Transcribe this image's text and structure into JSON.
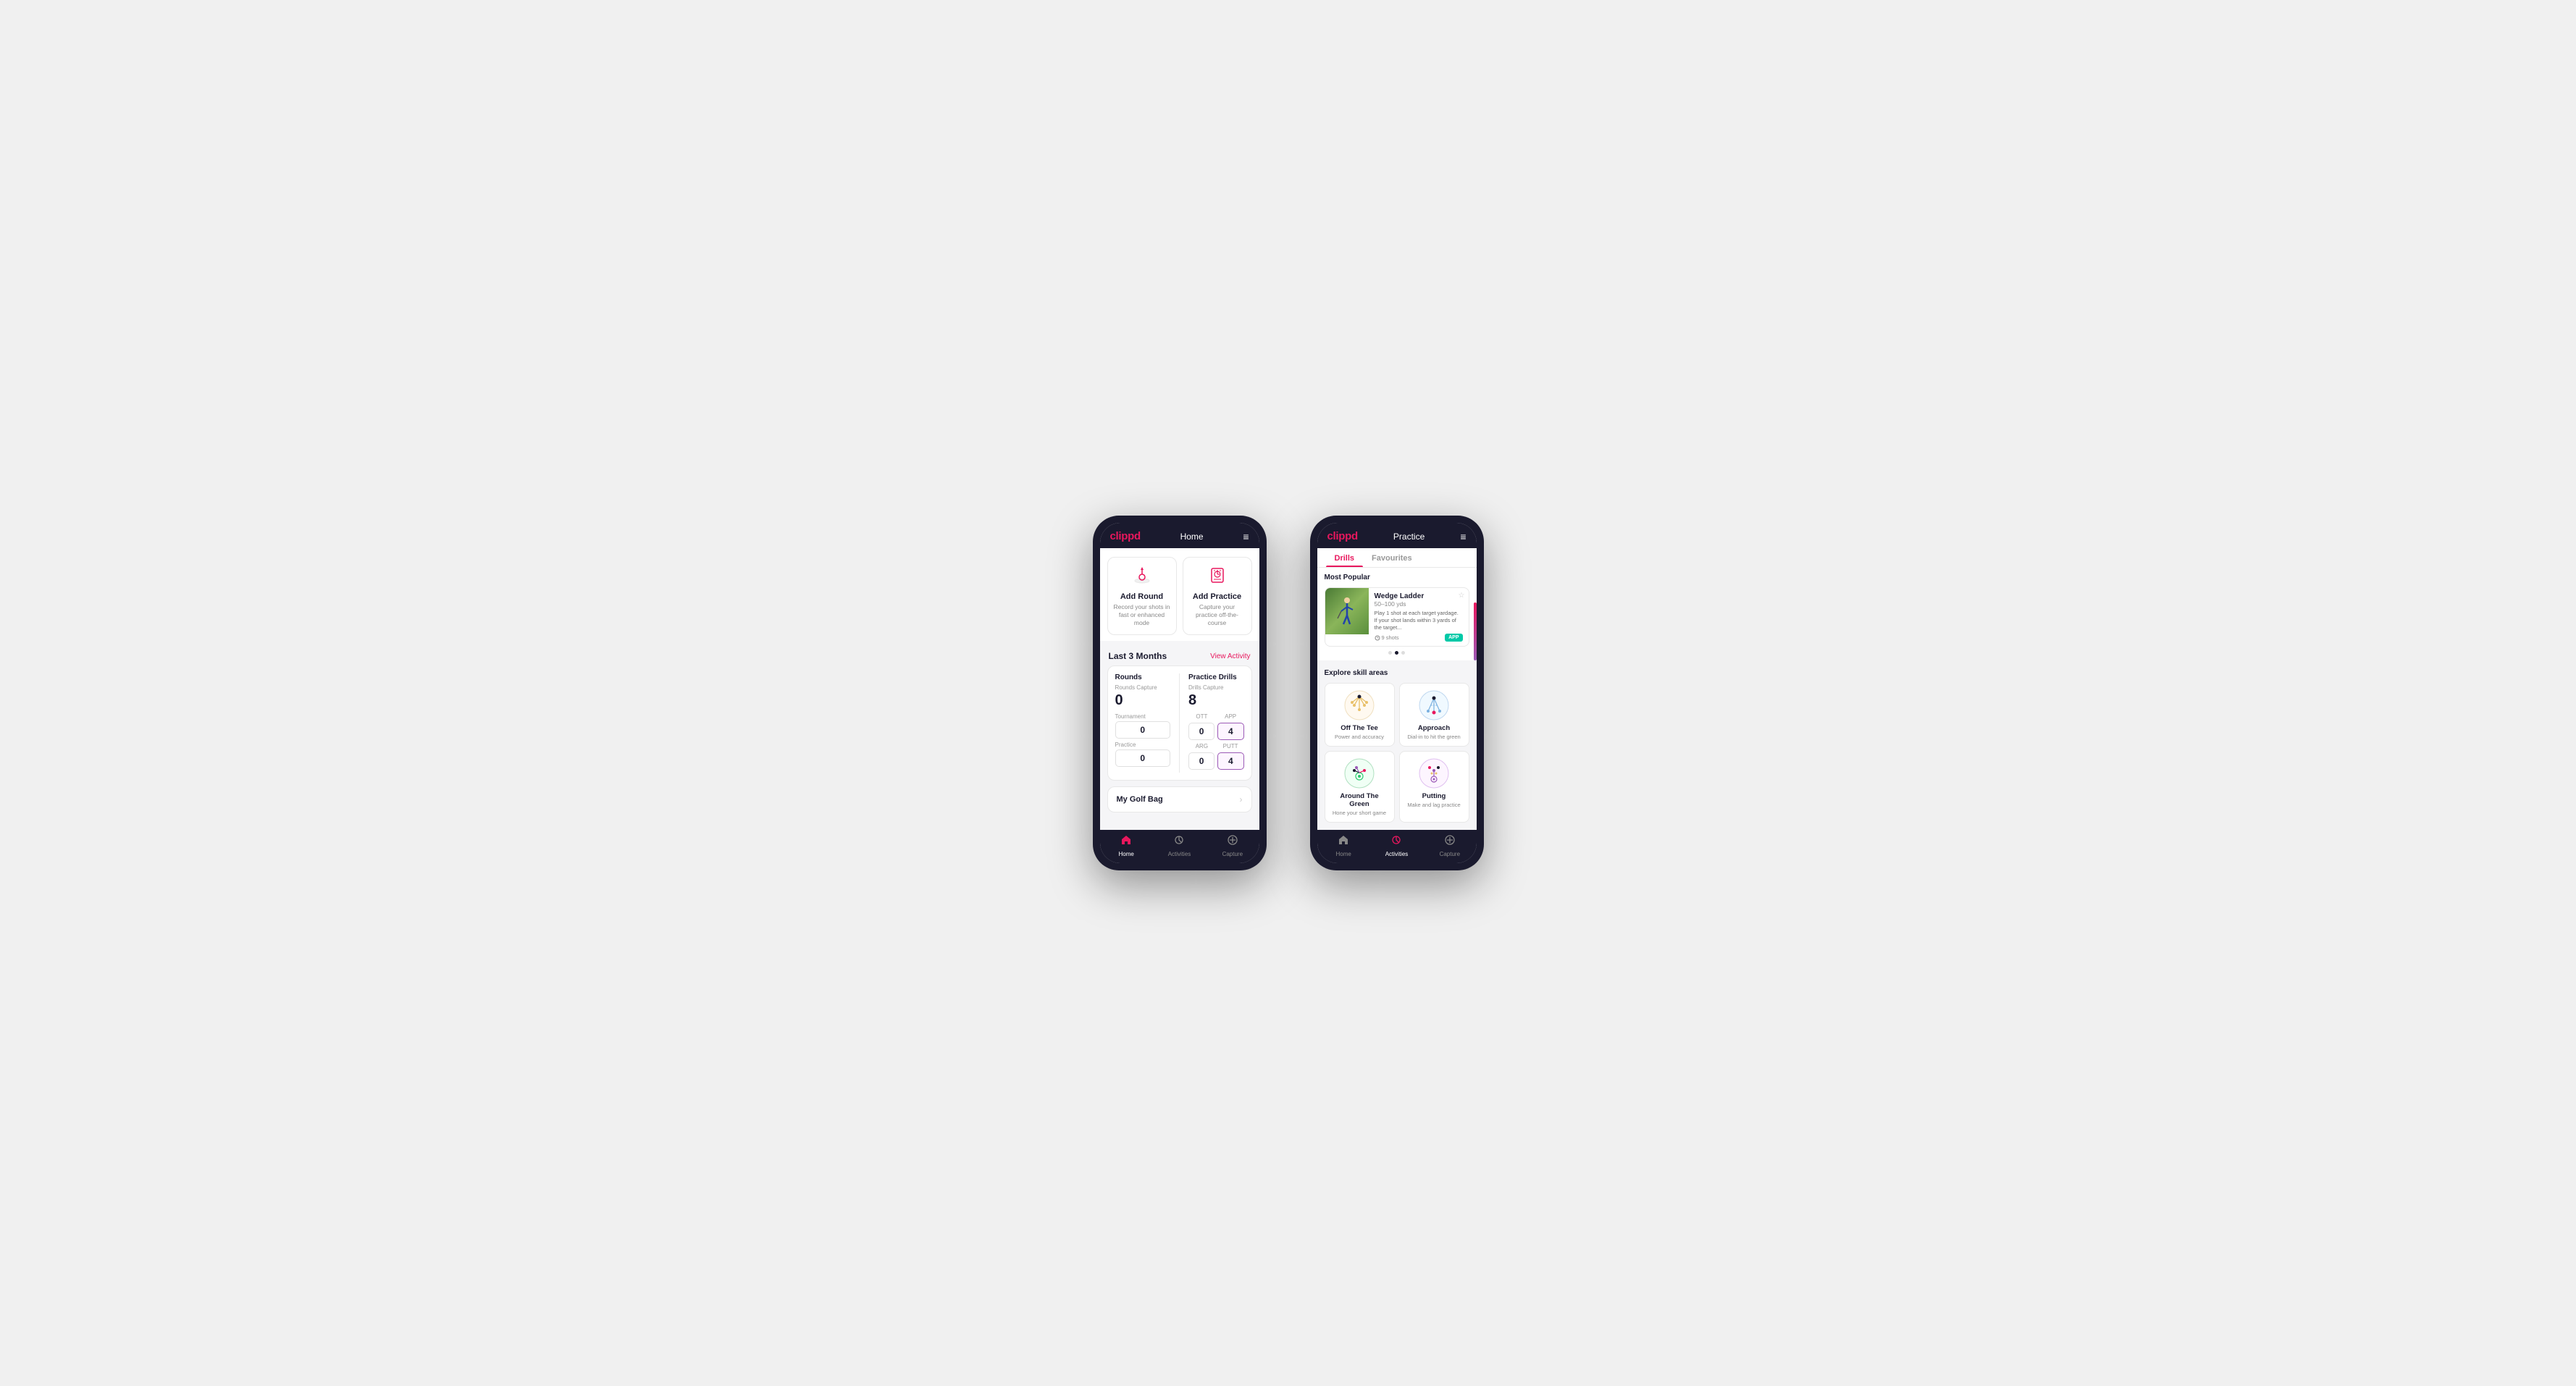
{
  "phone1": {
    "header": {
      "logo": "clippd",
      "title": "Home",
      "menu_icon": "≡"
    },
    "action_cards": [
      {
        "id": "add-round",
        "icon": "⛳",
        "title": "Add Round",
        "desc": "Record your shots in fast or enhanced mode"
      },
      {
        "id": "add-practice",
        "icon": "🎯",
        "title": "Add Practice",
        "desc": "Capture your practice off-the-course"
      }
    ],
    "activity": {
      "label": "Last 3 Months",
      "link": "View Activity"
    },
    "stats": {
      "rounds": {
        "title": "Rounds",
        "capture_label": "Rounds Capture",
        "total": "0",
        "sub_rows": [
          {
            "label": "Tournament",
            "values": [
              {
                "num": "0",
                "highlighted": false
              }
            ]
          },
          {
            "label": "Practice",
            "values": [
              {
                "num": "0",
                "highlighted": false
              }
            ]
          }
        ]
      },
      "drills": {
        "title": "Practice Drills",
        "capture_label": "Drills Capture",
        "total": "8",
        "sub_rows": [
          {
            "col_labels": [
              "OTT",
              "APP"
            ],
            "values": [
              {
                "num": "0",
                "highlighted": false
              },
              {
                "num": "4",
                "highlighted": true
              }
            ]
          },
          {
            "col_labels": [
              "ARG",
              "PUTT"
            ],
            "values": [
              {
                "num": "0",
                "highlighted": false
              },
              {
                "num": "4",
                "highlighted": true
              }
            ]
          }
        ]
      }
    },
    "golf_bag": {
      "label": "My Golf Bag"
    },
    "bottom_nav": [
      {
        "id": "home",
        "icon": "🏠",
        "label": "Home",
        "active": true
      },
      {
        "id": "activities",
        "icon": "☯",
        "label": "Activities",
        "active": false
      },
      {
        "id": "capture",
        "icon": "⊕",
        "label": "Capture",
        "active": false
      }
    ]
  },
  "phone2": {
    "header": {
      "logo": "clippd",
      "title": "Practice",
      "menu_icon": "≡"
    },
    "tabs": [
      {
        "label": "Drills",
        "active": true
      },
      {
        "label": "Favourites",
        "active": false
      }
    ],
    "most_popular": {
      "section_title": "Most Popular",
      "drill": {
        "name": "Wedge Ladder",
        "yardage": "50–100 yds",
        "desc": "Play 1 shot at each target yardage. If your shot lands within 3 yards of the target...",
        "shots": "9 shots",
        "badge": "APP"
      },
      "dots": [
        {
          "active": false
        },
        {
          "active": true
        },
        {
          "active": false
        }
      ]
    },
    "skill_areas": {
      "title": "Explore skill areas",
      "items": [
        {
          "id": "off-the-tee",
          "name": "Off The Tee",
          "desc": "Power and accuracy",
          "icon": "tee"
        },
        {
          "id": "approach",
          "name": "Approach",
          "desc": "Dial-in to hit the green",
          "icon": "approach"
        },
        {
          "id": "around-the-green",
          "name": "Around The Green",
          "desc": "Hone your short game",
          "icon": "around"
        },
        {
          "id": "putting",
          "name": "Putting",
          "desc": "Make and lag practice",
          "icon": "putting"
        }
      ]
    },
    "bottom_nav": [
      {
        "id": "home",
        "icon": "🏠",
        "label": "Home",
        "active": false
      },
      {
        "id": "activities",
        "icon": "☯",
        "label": "Activities",
        "active": true
      },
      {
        "id": "capture",
        "icon": "⊕",
        "label": "Capture",
        "active": false
      }
    ]
  }
}
